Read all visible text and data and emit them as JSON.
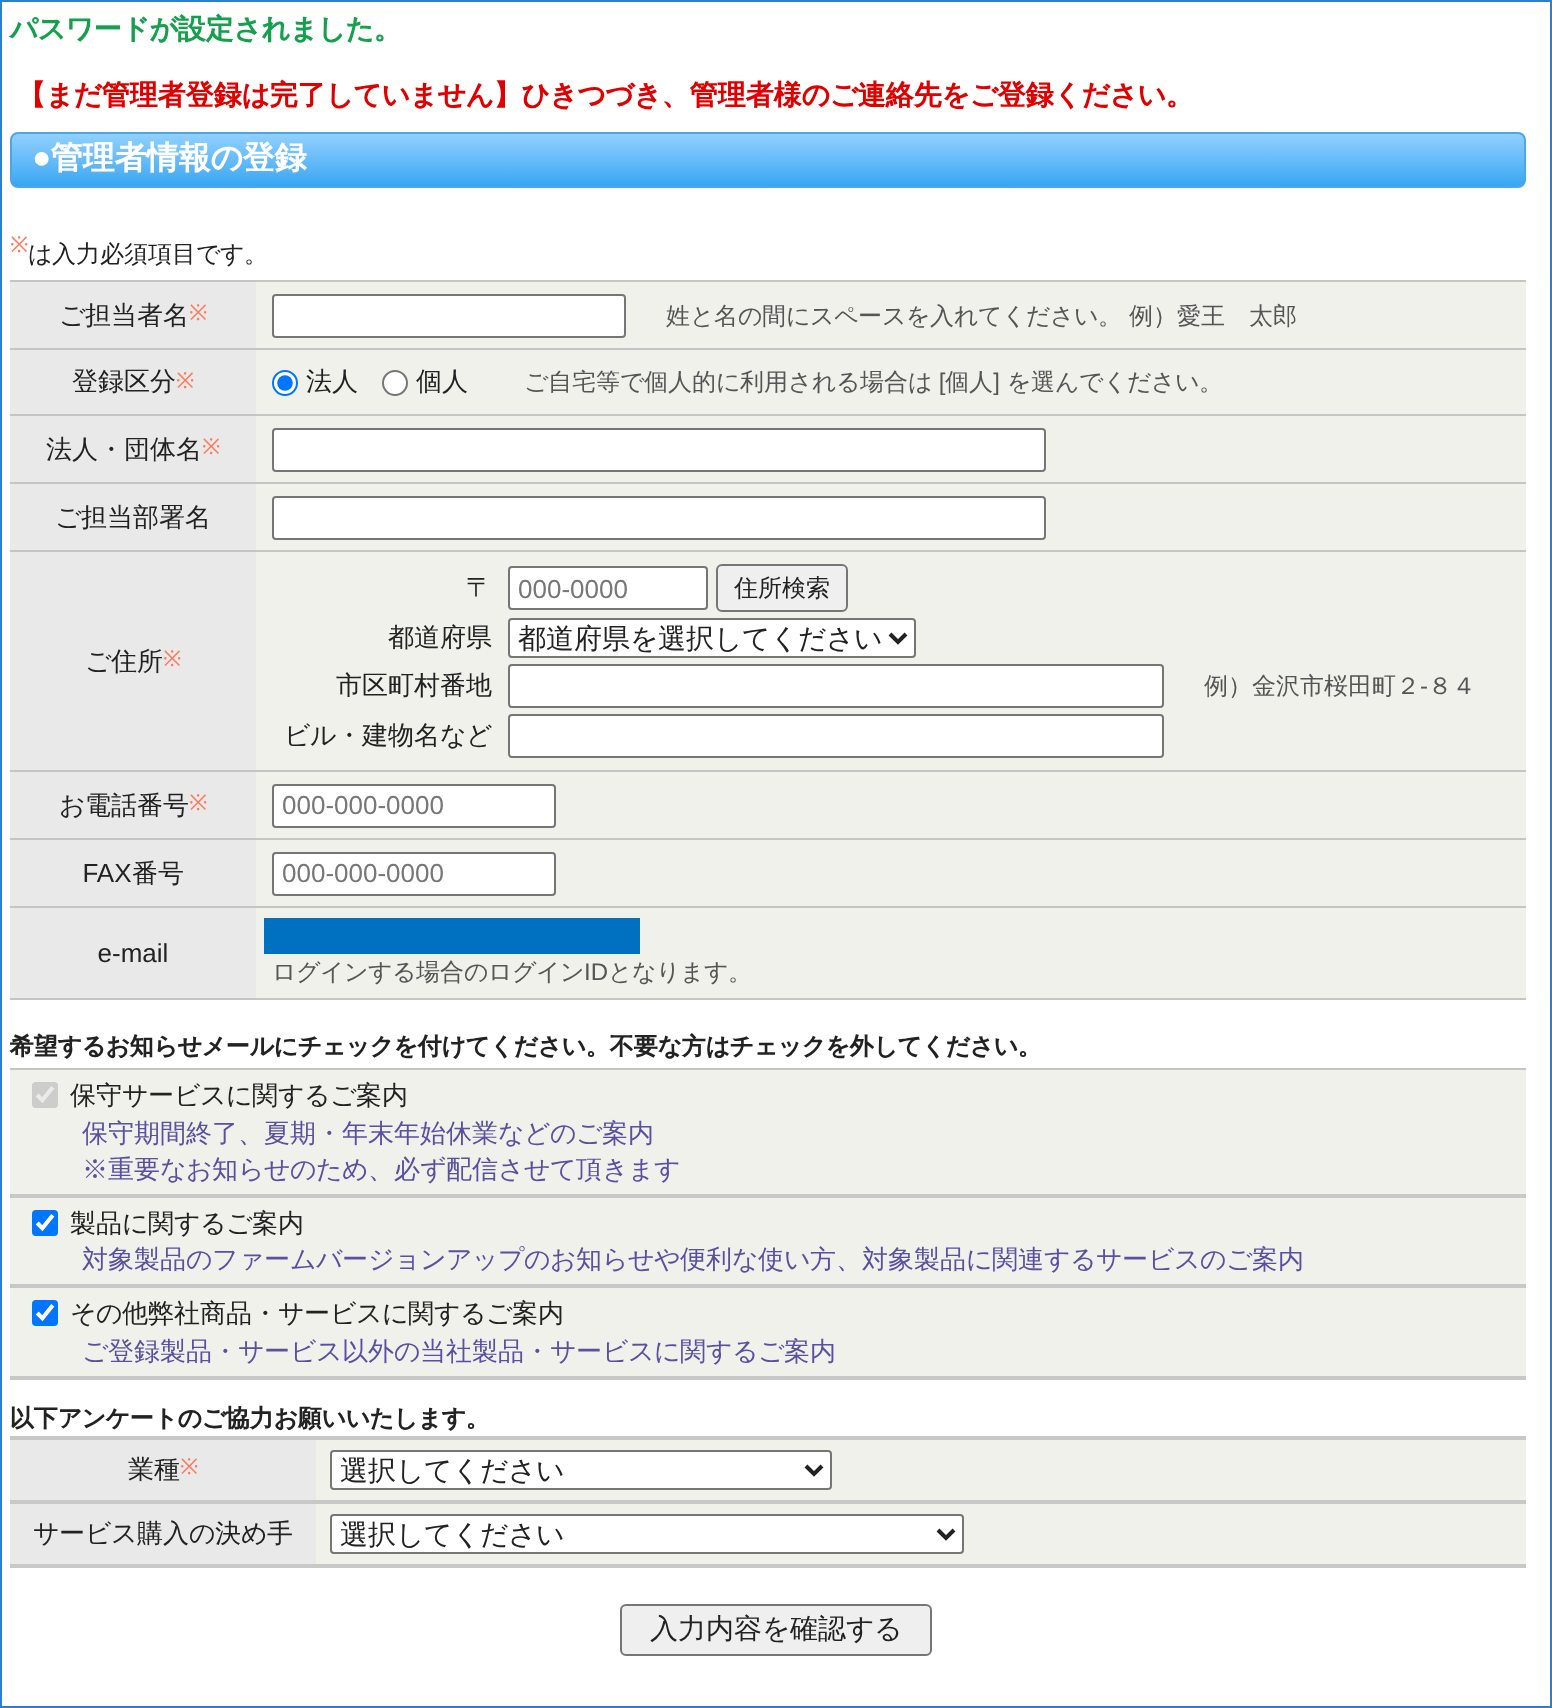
{
  "success_message": "パスワードが設定されました。",
  "warning_message": "【まだ管理者登録は完了していません】ひきつづき、管理者様のご連絡先をご登録ください。",
  "section_title": "●管理者情報の登録",
  "required_note": {
    "mark": "※",
    "text": "は入力必須項目です。"
  },
  "form_rows": [
    {
      "kind": "text",
      "label": "ご担当者名",
      "required_mark": "※",
      "hint": "姓と名の間にスペースを入れてください。 例）愛王　太郎"
    },
    {
      "kind": "radio",
      "label": "登録区分",
      "required_mark": "※",
      "options": [
        {
          "label": "法人",
          "selected": true
        },
        {
          "label": "個人",
          "selected": false
        }
      ],
      "hint": "ご自宅等で個人的に利用される場合は [個人] を選んでください。"
    },
    {
      "kind": "text",
      "label": "法人・団体名",
      "required_mark": "※"
    },
    {
      "kind": "text",
      "label": "ご担当部署名"
    },
    {
      "kind": "address",
      "label": "ご住所",
      "required_mark": "※",
      "postal_label": "〒",
      "postal_placeholder": "000-0000",
      "search_button": "住所検索",
      "prefecture_label": "都道府県",
      "prefecture_value": "都道府県を選択してください",
      "city_label": "市区町村番地",
      "city_hint": "例）金沢市桜田町２-８４",
      "building_label": "ビル・建物名など"
    },
    {
      "kind": "text",
      "label": "お電話番号",
      "required_mark": "※",
      "placeholder": "000-000-0000"
    },
    {
      "kind": "text",
      "label": "FAX番号",
      "placeholder": "000-000-0000"
    },
    {
      "kind": "email",
      "label": "e-mail",
      "hint": "ログインする場合のログインIDとなります。"
    }
  ],
  "mail_heading": "希望するお知らせメールにチェックを付けてください。不要な方はチェックを外してください。",
  "mail_options": [
    {
      "label": "保守サービスに関するご案内",
      "checked": true,
      "disabled": true,
      "details": [
        "保守期間終了、夏期・年末年始休業などのご案内",
        "※重要なお知らせのため、必ず配信させて頂きます"
      ]
    },
    {
      "label": "製品に関するご案内",
      "checked": true,
      "disabled": false,
      "details": [
        "対象製品のファームバージョンアップのお知らせや便利な使い方、対象製品に関連するサービスのご案内"
      ]
    },
    {
      "label": "その他弊社商品・サービスに関するご案内",
      "checked": true,
      "disabled": false,
      "details": [
        "ご登録製品・サービス以外の当社製品・サービスに関するご案内"
      ]
    }
  ],
  "survey_heading": "以下アンケートのご協力お願いいたします。",
  "survey_rows": [
    {
      "label": "業種",
      "required_mark": "※",
      "value": "選択してください"
    },
    {
      "label": "サービス購入の決め手",
      "value": "選択してください"
    }
  ],
  "confirm_button": "入力内容を確認する"
}
